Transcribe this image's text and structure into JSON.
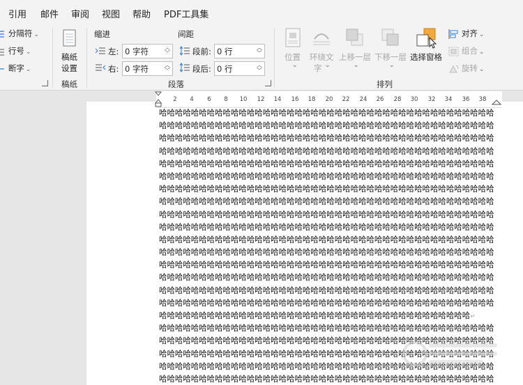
{
  "menu": [
    "引用",
    "邮件",
    "审阅",
    "视图",
    "帮助",
    "PDF工具集"
  ],
  "ribbon": {
    "left": {
      "breaks": "分隔符",
      "line_numbers": "行号",
      "hyphenation": "断字"
    },
    "draft": {
      "button_line1": "稿纸",
      "button_line2": "设置",
      "group_label": "稿纸"
    },
    "paragraph": {
      "indent_label": "缩进",
      "spacing_label": "间距",
      "left_label": "左:",
      "left_value": "0 字符",
      "right_label": "右:",
      "right_value": "0 字符",
      "before_label": "段前:",
      "before_value": "0 行",
      "after_label": "段后:",
      "after_value": "0 行",
      "group_label": "段落"
    },
    "arrange": {
      "position": "位置",
      "wrap_line1": "环绕文",
      "wrap_line2": "字",
      "bring_forward": "上移一层",
      "send_backward": "下移一层",
      "selection_pane": "选择窗格",
      "align": "对齐",
      "group": "组合",
      "rotate": "旋转",
      "group_label": "排列"
    }
  },
  "ruler": [
    "2",
    "4",
    "6",
    "8",
    "10",
    "12",
    "14",
    "16",
    "18",
    "20",
    "22",
    "24",
    "26",
    "28",
    "30",
    "32",
    "34",
    "36",
    "38"
  ],
  "document": {
    "line": "哈哈哈哈哈哈哈哈哈哈哈哈哈哈哈哈哈哈哈哈哈哈哈哈哈哈哈哈哈哈哈哈哈哈哈哈哈哈哈哈哈哈",
    "para_end_line": "哈哈哈哈哈哈哈哈哈哈哈哈哈哈哈哈哈哈哈哈哈哈哈哈哈哈哈哈哈哈哈哈哈哈哈哈哈哈哈",
    "para_mark": "↵",
    "lines_before": 16,
    "lines_after": 5
  },
  "colors": {
    "accent_orange": "#f2a93b",
    "accent_blue": "#2b7cd3",
    "ribbon_bg": "#f3f3f3"
  }
}
